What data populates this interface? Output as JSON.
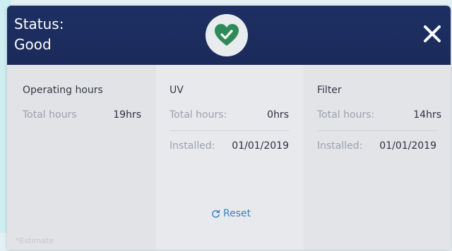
{
  "header": {
    "status_label": "Status:",
    "status_value": "Good",
    "status_icon": "heart-check-icon",
    "close_icon": "close-icon",
    "header_color": "#1e2f63",
    "badge_color": "#2e8b57"
  },
  "columns": [
    {
      "title": "Operating hours",
      "rows": [
        {
          "label": "Total hours",
          "value": "19hrs"
        }
      ]
    },
    {
      "title": "UV",
      "rows": [
        {
          "label": "Total hours:",
          "value": "0hrs"
        },
        {
          "label": "Installed:",
          "value": "01/01/2019"
        }
      ]
    },
    {
      "title": "Filter",
      "rows": [
        {
          "label": "Total hours:",
          "value": "14hrs"
        },
        {
          "label": "Installed:",
          "value": "01/01/2019"
        }
      ]
    }
  ],
  "reset": {
    "label": "Reset",
    "icon": "refresh-icon",
    "color": "#3d7fc8"
  },
  "footnote": "*Estimate"
}
